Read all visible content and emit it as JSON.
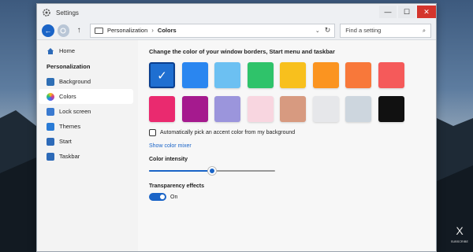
{
  "window": {
    "title": "Settings",
    "controls": {
      "minimize": "—",
      "maximize": "☐",
      "close": "✕"
    }
  },
  "navbar": {
    "back_icon": "arrow-left-icon",
    "forward_icon": "arrow-right-icon",
    "up_icon": "arrow-up-icon",
    "up_glyph": "↑",
    "back_glyph": "←",
    "breadcrumb": [
      "Personalization",
      "Colors"
    ],
    "breadcrumb_sep": "›",
    "dropdown_glyph": "⌄",
    "refresh_glyph": "↻",
    "search_placeholder": "Find a setting",
    "search_glyph": "⌕"
  },
  "sidebar": {
    "home": "Home",
    "heading": "Personalization",
    "items": [
      {
        "label": "Background",
        "icon": "background-icon",
        "color": "#2f6fb5"
      },
      {
        "label": "Colors",
        "icon": "color-wheel-icon",
        "color": "#e0427a",
        "active": true
      },
      {
        "label": "Lock screen",
        "icon": "lock-screen-icon",
        "color": "#3a7ad0"
      },
      {
        "label": "Themes",
        "icon": "themes-icon",
        "color": "#2a7bd6"
      },
      {
        "label": "Start",
        "icon": "start-icon",
        "color": "#2d6ab8"
      },
      {
        "label": "Taskbar",
        "icon": "taskbar-icon",
        "color": "#2d6ab8"
      }
    ]
  },
  "content": {
    "title": "Change the color of your window borders, Start menu and taskbar",
    "swatches": [
      {
        "color": "#1f6fd1",
        "selected": true
      },
      {
        "color": "#2a86f0"
      },
      {
        "color": "#6cc0f2"
      },
      {
        "color": "#2fc36a"
      },
      {
        "color": "#f8c01d"
      },
      {
        "color": "#fb9420"
      },
      {
        "color": "#f8783a"
      },
      {
        "color": "#f55a5a"
      },
      {
        "color": "#ea2a6f"
      },
      {
        "color": "#a51a8e"
      },
      {
        "color": "#9b95dc"
      },
      {
        "color": "#f8d6e0"
      },
      {
        "color": "#d79a80"
      },
      {
        "color": "#e6e7ea"
      },
      {
        "color": "#cdd6de"
      },
      {
        "color": "#111111"
      }
    ],
    "check_glyph": "✓",
    "auto_accent_label": "Automatically pick an accent color from my background",
    "auto_accent_checked": false,
    "color_mixer_link": "Show color mixer",
    "intensity_label": "Color intensity",
    "intensity_value": 0.5,
    "transparency_label": "Transparency effects",
    "transparency_state": "On",
    "transparency_on": true
  },
  "accent_color": "#1a64c7",
  "corner_logo": {
    "glyph": "X",
    "sub": "SUBSCRIBE"
  }
}
